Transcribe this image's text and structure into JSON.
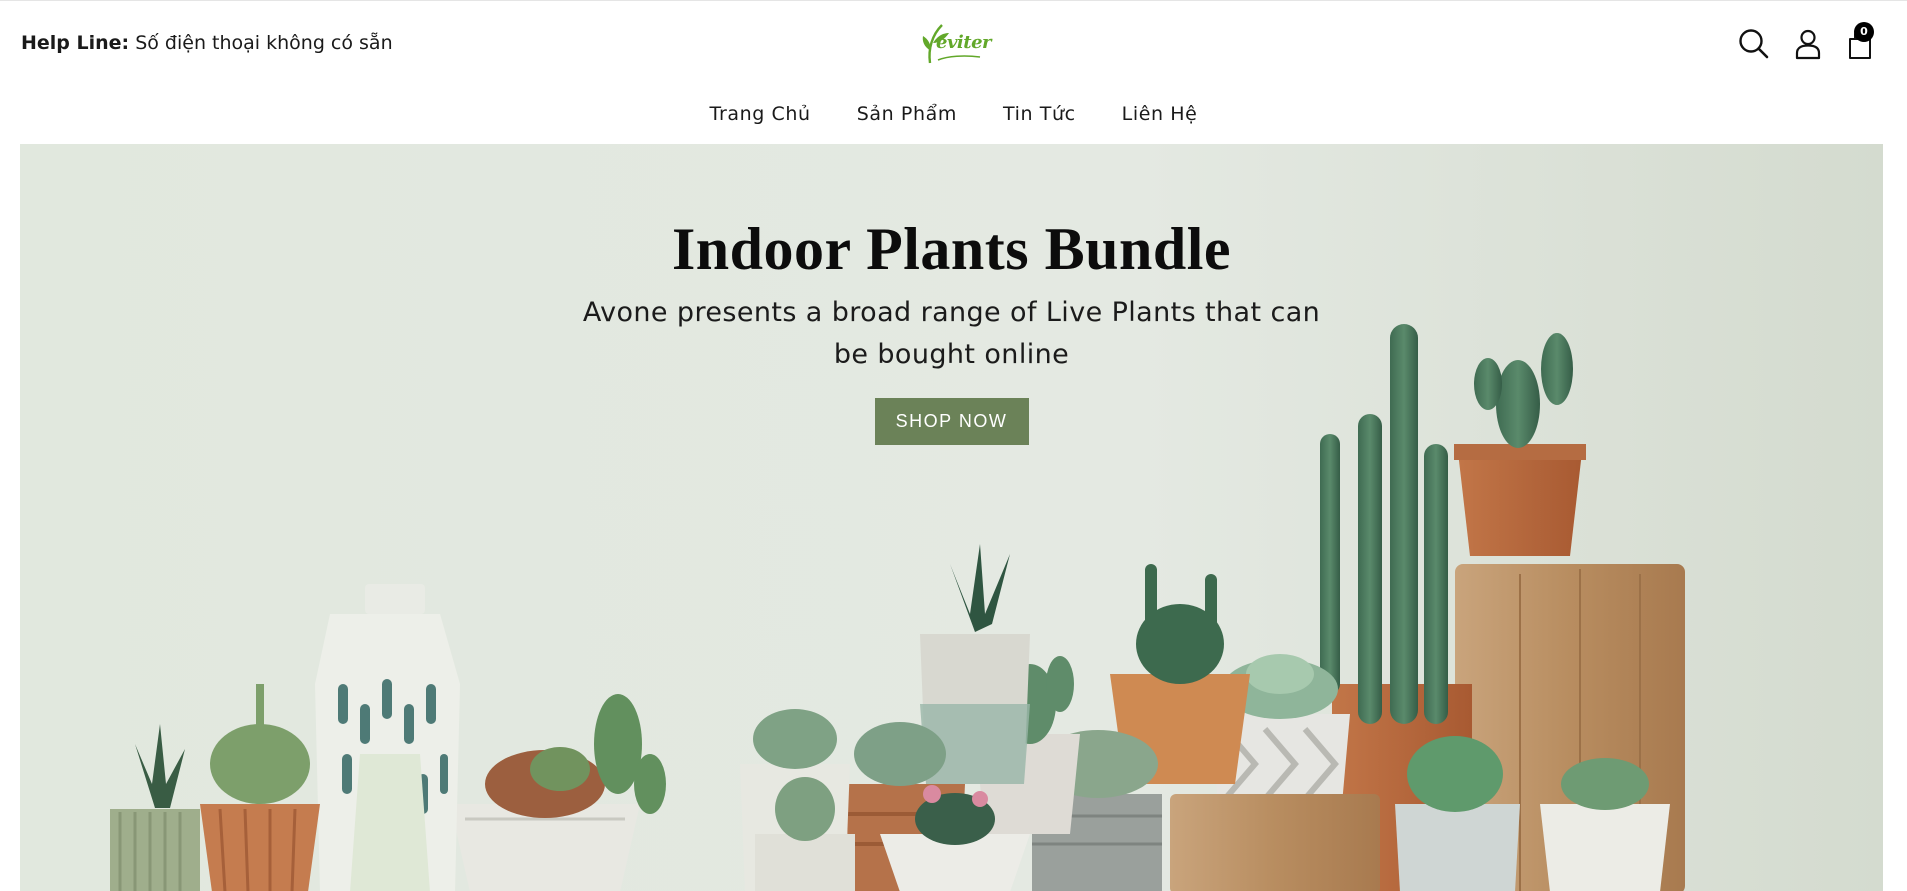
{
  "header": {
    "helpline_label": "Help Line:",
    "helpline_value": "Số điện thoại không có sẵn",
    "logo_text": "eviter",
    "cart_count": "0",
    "icons": [
      "search-icon",
      "account-icon",
      "cart-icon"
    ]
  },
  "nav": {
    "items": [
      {
        "label": "Trang Chủ"
      },
      {
        "label": "Sản Phẩm"
      },
      {
        "label": "Tin Tức"
      },
      {
        "label": "Liên Hệ"
      }
    ]
  },
  "hero": {
    "title": "Indoor Plants Bundle",
    "subtitle": "Avone presents a broad range of Live Plants that can be bought online",
    "button_label": "SHOP NOW"
  },
  "colors": {
    "accent": "#6b8258",
    "logo_green": "#62a82a",
    "hero_background": "#dfe6dc"
  }
}
